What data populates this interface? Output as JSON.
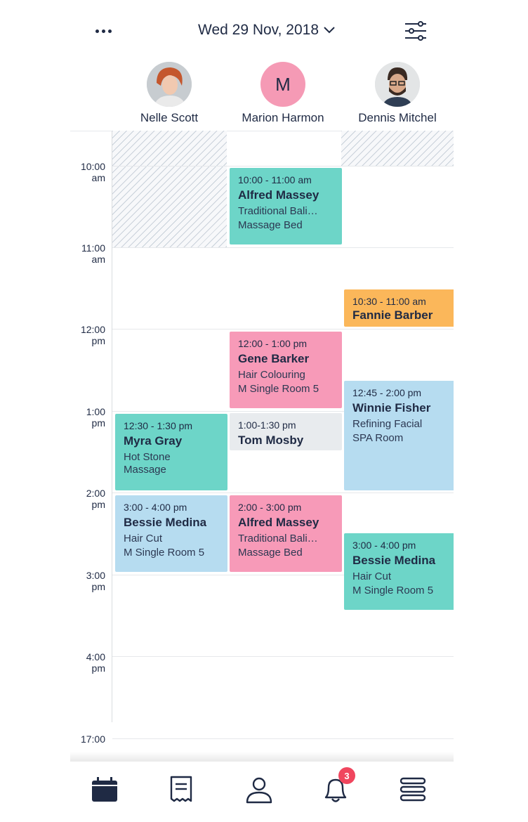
{
  "header": {
    "more_icon": "more-horizontal-icon",
    "date_label": "Wed 29 Nov, 2018",
    "date_dropdown_icon": "chevron-down-icon",
    "filter_icon": "sliders-icon"
  },
  "staff": [
    {
      "name": "Nelle Scott",
      "avatar": "photo"
    },
    {
      "name": "Marion Harmon",
      "avatar_initial": "M",
      "avatar_color": "#f59ab5"
    },
    {
      "name": "Dennis Mitchel",
      "avatar": "photo"
    }
  ],
  "time_labels": [
    {
      "line1": "10:00",
      "line2": "am"
    },
    {
      "line1": "11:00",
      "line2": "am"
    },
    {
      "line1": "12:00",
      "line2": "pm"
    },
    {
      "line1": "1:00",
      "line2": "pm"
    },
    {
      "line1": "2:00",
      "line2": "pm"
    },
    {
      "line1": "3:00",
      "line2": "pm"
    },
    {
      "line1": "4:00",
      "line2": "pm"
    },
    {
      "line1": "17:00",
      "line2": ""
    }
  ],
  "appointments": {
    "marion_1": {
      "time": "10:00 - 11:00 am",
      "client": "Alfred Massey",
      "service": "Traditional Bali…",
      "room": "Massage Bed",
      "color": "#6dd5c8"
    },
    "dennis_1": {
      "time": "10:30 - 11:00 am",
      "client": "Fannie Barber",
      "color": "#fbb75a"
    },
    "marion_2": {
      "time": "12:00 - 1:00 pm",
      "client": "Gene Barker",
      "service": "Hair Colouring",
      "room": "M Single Room 5",
      "color": "#f79ab8"
    },
    "dennis_2": {
      "time": "12:45 - 2:00 pm",
      "client": "Winnie Fisher",
      "service": "Refining Facial",
      "room": "SPA Room",
      "color": "#b6dcf0"
    },
    "nelle_1": {
      "time": "12:30 - 1:30 pm",
      "client": "Myra Gray",
      "service": "Hot Stone",
      "room": "Massage",
      "color": "#6dd5c8"
    },
    "marion_3": {
      "time": "1:00-1:30 pm",
      "client": "Tom Mosby",
      "color": "#e8ebee"
    },
    "nelle_2": {
      "time": "3:00 - 4:00 pm",
      "client": "Bessie Medina",
      "service": "Hair Cut",
      "room": "M Single Room 5",
      "color": "#b6dcf0"
    },
    "marion_4": {
      "time": "2:00 - 3:00 pm",
      "client": "Alfred Massey",
      "service": "Traditional Bali…",
      "room": "Massage Bed",
      "color": "#f79ab8"
    },
    "dennis_3": {
      "time": "3:00 - 4:00 pm",
      "client": "Bessie Medina",
      "service": "Hair Cut",
      "room": "M Single Room 5",
      "color": "#6dd5c8"
    }
  },
  "tabbar": {
    "items": [
      {
        "icon": "calendar-icon",
        "active": true
      },
      {
        "icon": "receipt-icon",
        "active": false
      },
      {
        "icon": "user-icon",
        "active": false
      },
      {
        "icon": "bell-icon",
        "active": false,
        "badge": "3"
      },
      {
        "icon": "menu-icon",
        "active": false
      }
    ],
    "notification_badge": "3"
  }
}
